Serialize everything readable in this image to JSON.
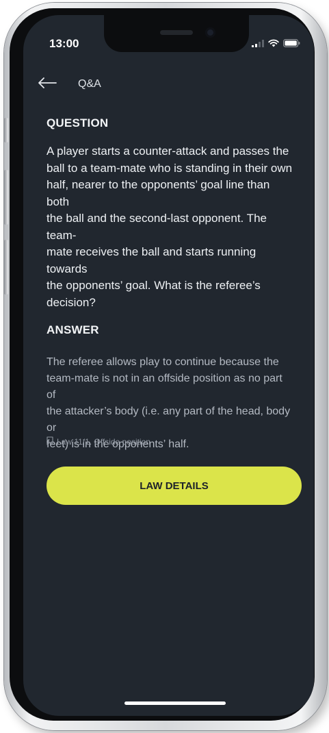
{
  "status_bar": {
    "time": "13:00",
    "icons": [
      "signal-icon",
      "wifi-icon",
      "battery-icon"
    ]
  },
  "nav": {
    "back_icon": "arrow-left-icon",
    "title": "Q&A"
  },
  "question": {
    "heading": "QUESTION",
    "lines": [
      "A player starts a counter-attack and passes the",
      "ball to a team-mate who is standing in their own",
      "half, nearer to the opponents’ goal line than both",
      "the ball and the second-last opponent. The team-",
      "mate receives the ball and starts running towards",
      "the opponents’ goal. What is the referee’s",
      "decision?"
    ]
  },
  "answer": {
    "heading": "ANSWER",
    "lines": [
      "The referee allows play to continue because the",
      "team-mate is not in an offside position as no part of",
      "the attacker’s body (i.e. any part of the head, body or",
      "feet) is in the opponents’ half."
    ]
  },
  "law_reference": {
    "icon": "bookmark-icon",
    "text": "Law 11/1. Offside position"
  },
  "law_details_button": {
    "label": "LAW DETAILS"
  },
  "colors": {
    "screen_background": "#21272f",
    "accent": "#dbe44a",
    "text_primary": "#eef1f4",
    "text_secondary": "#b4bac3"
  }
}
